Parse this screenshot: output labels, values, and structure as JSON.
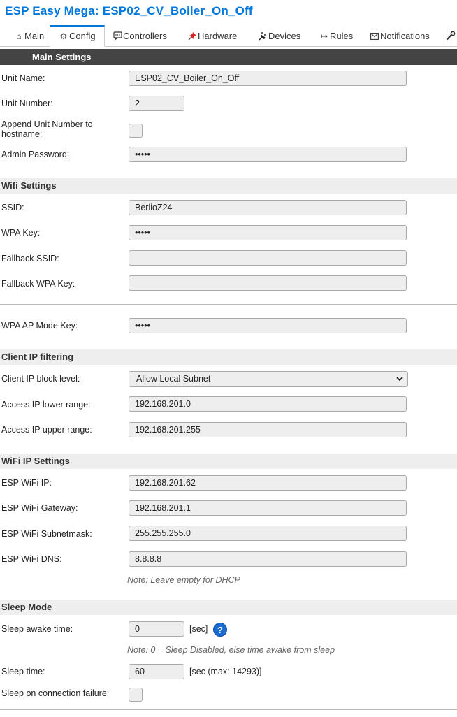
{
  "header": {
    "title": "ESP Easy Mega: ESP02_CV_Boiler_On_Off"
  },
  "tabs": [
    {
      "label": "Main",
      "icon": "home-icon"
    },
    {
      "label": "Config",
      "icon": "gear-icon"
    },
    {
      "label": "Controllers",
      "icon": "chat-icon"
    },
    {
      "label": "Hardware",
      "icon": "pin-icon"
    },
    {
      "label": "Devices",
      "icon": "plug-icon"
    },
    {
      "label": "Rules",
      "icon": "arrow-icon"
    },
    {
      "label": "Notifications",
      "icon": "envelope-icon"
    }
  ],
  "main_settings": {
    "header": "Main Settings",
    "unit_name_label": "Unit Name:",
    "unit_name_value": "ESP02_CV_Boiler_On_Off",
    "unit_number_label": "Unit Number:",
    "unit_number_value": "2",
    "append_label_1": "Append Unit Number to",
    "append_label_2": "hostname:",
    "admin_password_label": "Admin Password:",
    "admin_password_value": "•••••"
  },
  "wifi_settings": {
    "header": "Wifi Settings",
    "ssid_label": "SSID:",
    "ssid_value": "BerlioZ24",
    "wpa_key_label": "WPA Key:",
    "wpa_key_value": "•••••",
    "fallback_ssid_label": "Fallback SSID:",
    "fallback_ssid_value": "",
    "fallback_wpa_label": "Fallback WPA Key:",
    "fallback_wpa_value": "",
    "ap_key_label": "WPA AP Mode Key:",
    "ap_key_value": "•••••"
  },
  "client_ip": {
    "header": "Client IP filtering",
    "block_level_label": "Client IP block level:",
    "block_level_value": "Allow Local Subnet",
    "lower_label": "Access IP lower range:",
    "lower_value": "192.168.201.0",
    "upper_label": "Access IP upper range:",
    "upper_value": "192.168.201.255"
  },
  "wifi_ip": {
    "header": "WiFi IP Settings",
    "ip_label": "ESP WiFi IP:",
    "ip_value": "192.168.201.62",
    "gateway_label": "ESP WiFi Gateway:",
    "gateway_value": "192.168.201.1",
    "subnet_label": "ESP WiFi Subnetmask:",
    "subnet_value": "255.255.255.0",
    "dns_label": "ESP WiFi DNS:",
    "dns_value": "8.8.8.8",
    "note": "Note: Leave empty for DHCP"
  },
  "sleep": {
    "header": "Sleep Mode",
    "awake_label": "Sleep awake time:",
    "awake_value": "0",
    "awake_unit": "[sec]",
    "help_symbol": "?",
    "awake_note": "Note: 0 = Sleep Disabled, else time awake from sleep",
    "sleep_time_label": "Sleep time:",
    "sleep_time_value": "60",
    "sleep_time_unit": "[sec (max: 14293)]",
    "conn_fail_label": "Sleep on connection failure:"
  },
  "colors": {
    "title": "#0077dd",
    "main_header_bg": "#444444",
    "section_bg": "#eeeeee",
    "help": "#1a6bd3"
  }
}
